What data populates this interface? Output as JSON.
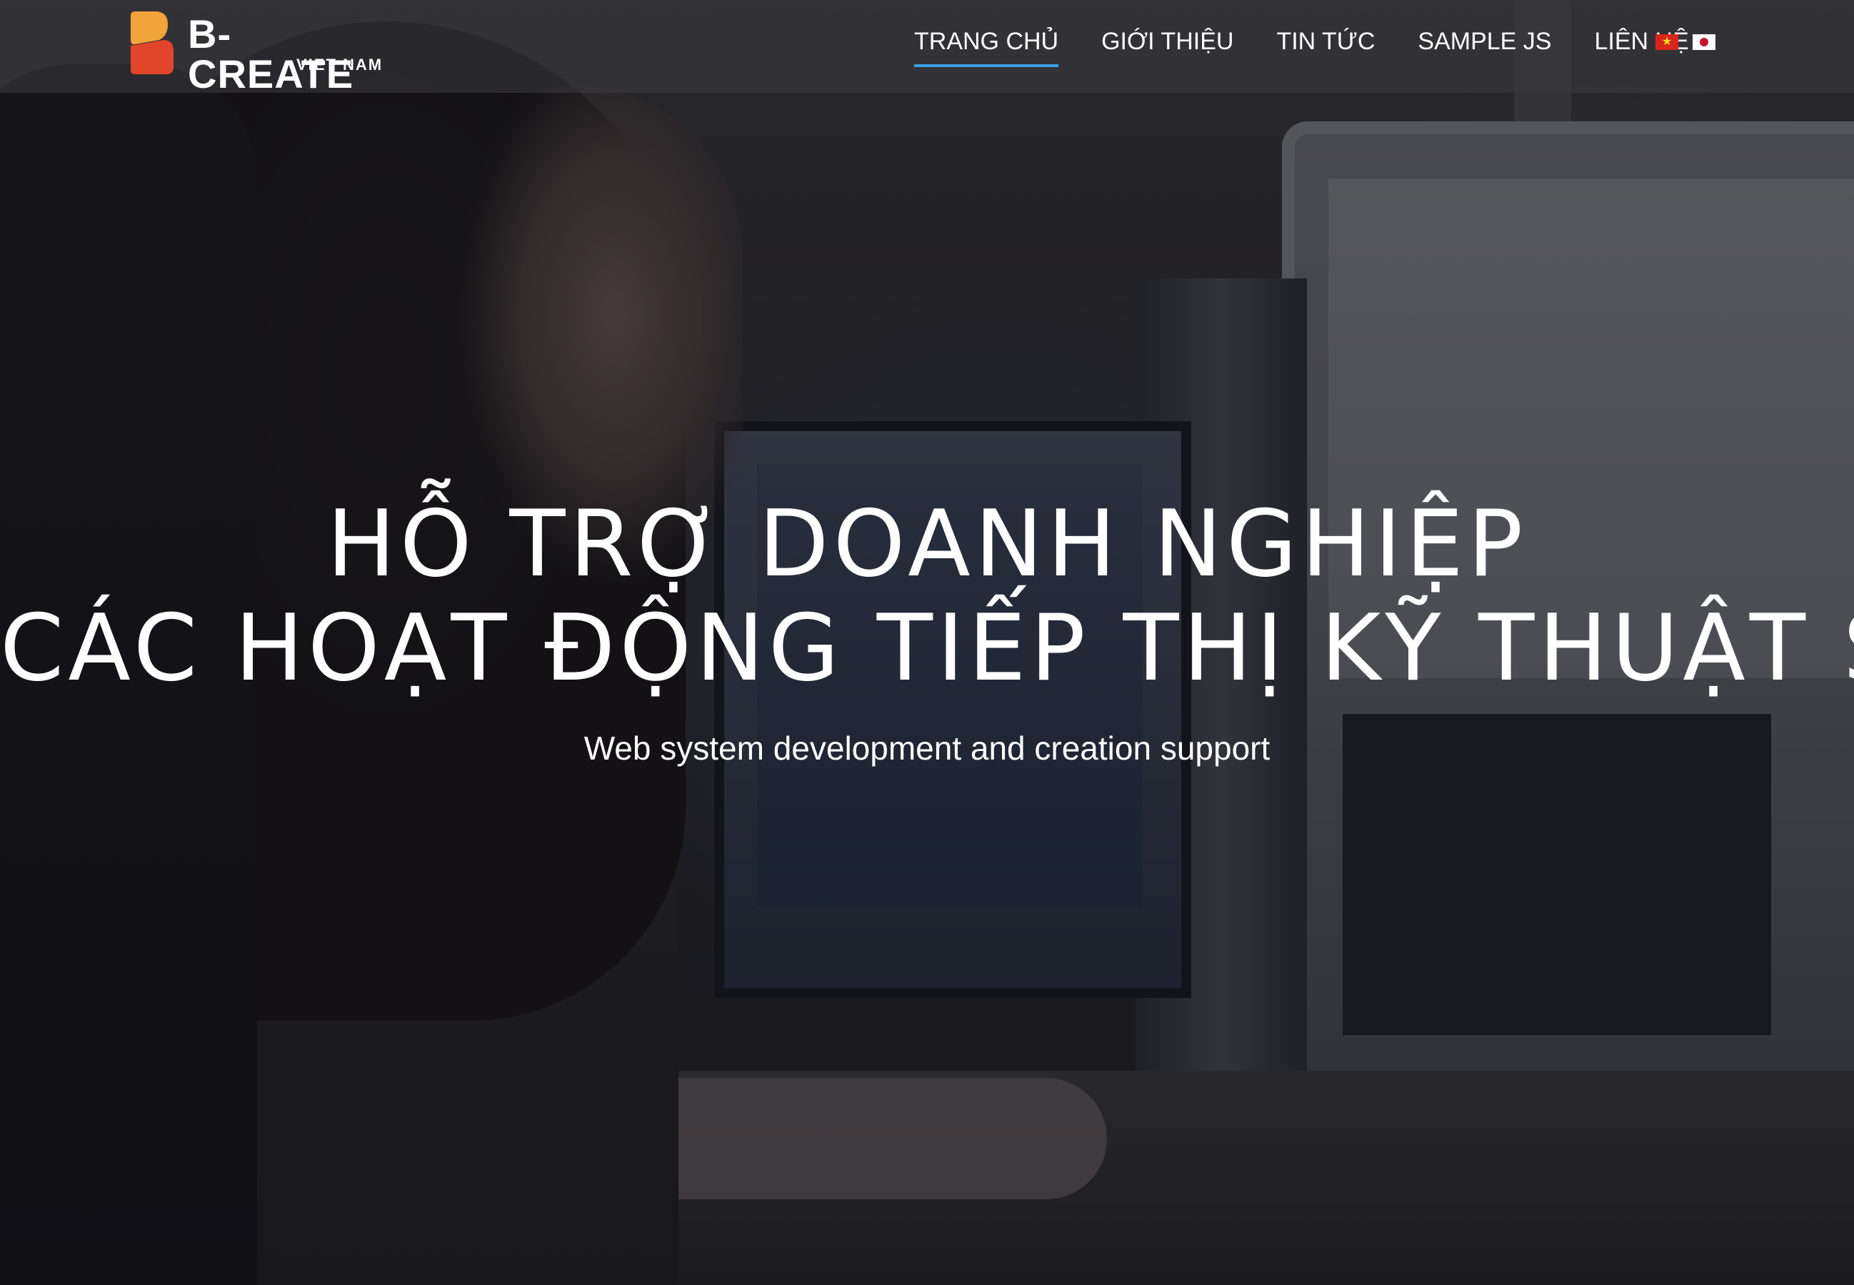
{
  "brand": {
    "name": "B-CREATE",
    "tagline": "VIET NAM",
    "colors": {
      "top": "#f2a33a",
      "bottom": "#e2452a"
    }
  },
  "nav": {
    "items": [
      {
        "label": "TRANG CHỦ",
        "active": true
      },
      {
        "label": "GIỚI THIỆU",
        "active": false
      },
      {
        "label": "TIN TỨC",
        "active": false
      },
      {
        "label": "SAMPLE JS",
        "active": false
      },
      {
        "label": "LIÊN HỆ",
        "active": false
      }
    ],
    "accent_color": "#3da0e4"
  },
  "languages": [
    {
      "icon": "vietnam-flag-icon"
    },
    {
      "icon": "japan-flag-icon"
    }
  ],
  "hero": {
    "title_line1": "HỖ TRỢ DOANH NGHIỆP",
    "title_line2": "CÁC HOẠT ĐỘNG TIẾP THỊ KỸ THUẬT SỐ",
    "subtitle": "Web system development and creation support"
  }
}
